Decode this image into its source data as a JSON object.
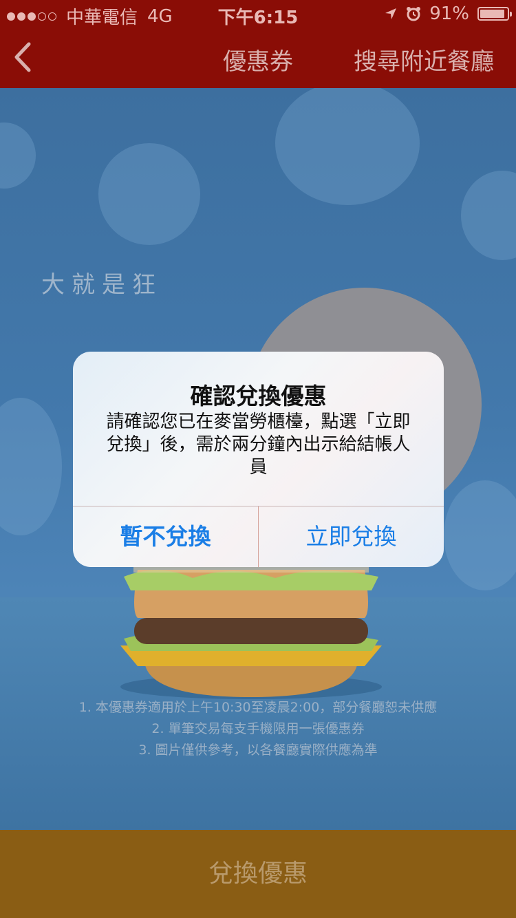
{
  "status_bar": {
    "carrier": "中華電信",
    "network": "4G",
    "time": "下午6:15",
    "battery": "91%",
    "battery_level": 0.91,
    "signal_bars_filled": 3,
    "signal_bars_total": 5
  },
  "nav": {
    "back_icon": "chevron-left-icon",
    "title": "優惠券",
    "right_link": "搜尋附近餐廳"
  },
  "hero": {
    "slogan": "大就是狂"
  },
  "terms": [
    "1. 本優惠券適用於上午10:30至凌晨2:00，部分餐廳恕未供應",
    "2. 單筆交易每支手機限用一張優惠券",
    "3. 圖片僅供參考，以各餐廳實際供應為準"
  ],
  "cta": {
    "label": "兌換優惠"
  },
  "alert": {
    "title": "確認兌換優惠",
    "message": "請確認您已在麥當勞櫃檯，點選「立即兌換」後，需於兩分鐘內出示給結帳人員",
    "cancel_label": "暫不兌換",
    "confirm_label": "立即兌換"
  },
  "colors": {
    "nav_bg": "#8a0d06",
    "cta_bg": "#8a5d14",
    "alert_button_text": "#1a7ee6"
  }
}
